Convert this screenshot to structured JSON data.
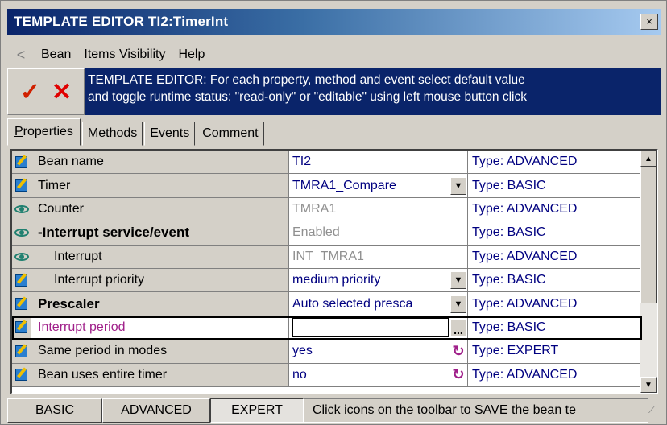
{
  "window": {
    "title": "TEMPLATE EDITOR TI2:TimerInt",
    "close_label": "×"
  },
  "menubar": {
    "back_label": "<",
    "items": [
      "Bean",
      "Items Visibility",
      "Help"
    ]
  },
  "toolbar": {
    "confirm_icon": "checkmark-icon",
    "cancel_icon": "cross-icon",
    "banner_line1": "TEMPLATE EDITOR: For each property, method and event select default value",
    "banner_line2": "and toggle runtime status: \"read-only\" or \"editable\" using left mouse button click",
    "accent_color": "#0a246a"
  },
  "tabs": [
    {
      "prefix": "",
      "accel": "P",
      "rest": "roperties",
      "active": true
    },
    {
      "prefix": "",
      "accel": "M",
      "rest": "ethods",
      "active": false
    },
    {
      "prefix": "",
      "accel": "E",
      "rest": "vents",
      "active": false
    },
    {
      "prefix": "",
      "accel": "C",
      "rest": "omment",
      "active": false
    }
  ],
  "properties": [
    {
      "icon": "edit-icon",
      "name": "Bean name",
      "value": "TI2",
      "type": "Type: ADVANCED",
      "control": "none",
      "bold": false,
      "disabled": false
    },
    {
      "icon": "edit-icon",
      "name": "Timer",
      "value": "TMRA1_Compare",
      "type": "Type: BASIC",
      "control": "dropdown",
      "bold": false,
      "disabled": false
    },
    {
      "icon": "eye-icon",
      "name": "Counter",
      "value": "TMRA1",
      "type": "Type: ADVANCED",
      "control": "none",
      "bold": false,
      "disabled": true
    },
    {
      "icon": "eye-icon",
      "name": "-Interrupt service/event",
      "value": "Enabled",
      "type": "Type: BASIC",
      "control": "none",
      "bold": true,
      "disabled": true
    },
    {
      "icon": "eye-icon",
      "name": "Interrupt",
      "value": "INT_TMRA1",
      "type": "Type: ADVANCED",
      "control": "none",
      "bold": false,
      "disabled": true,
      "indent": true
    },
    {
      "icon": "edit-icon",
      "name": "Interrupt priority",
      "value": "medium priority",
      "type": "Type: BASIC",
      "control": "dropdown",
      "bold": false,
      "disabled": false,
      "indent": true
    },
    {
      "icon": "edit-icon",
      "name": "Prescaler",
      "value": "Auto selected presca",
      "type": "Type: ADVANCED",
      "control": "dropdown",
      "bold": true,
      "disabled": false
    },
    {
      "icon": "edit-icon",
      "name": "Interrupt period",
      "value": "",
      "type": "Type: BASIC",
      "control": "ellipsis",
      "bold": false,
      "disabled": false,
      "selected": true
    },
    {
      "icon": "edit-icon",
      "name": "Same period in modes",
      "value": "yes",
      "type": "Type: EXPERT",
      "control": "cycle",
      "bold": false,
      "disabled": false
    },
    {
      "icon": "edit-icon",
      "name": "Bean uses entire timer",
      "value": "no",
      "type": "Type: ADVANCED",
      "control": "cycle",
      "bold": false,
      "disabled": false
    }
  ],
  "controls": {
    "dropdown_glyph": "▼",
    "ellipsis_glyph": "...",
    "cycle_glyph": "↻",
    "scroll_up_glyph": "▲",
    "scroll_down_glyph": "▼"
  },
  "statusbar": {
    "buttons": [
      {
        "label": "BASIC",
        "pressed": false
      },
      {
        "label": "ADVANCED",
        "pressed": false
      },
      {
        "label": "EXPERT",
        "pressed": true
      }
    ],
    "message": "Click icons on the toolbar to SAVE the bean te"
  }
}
